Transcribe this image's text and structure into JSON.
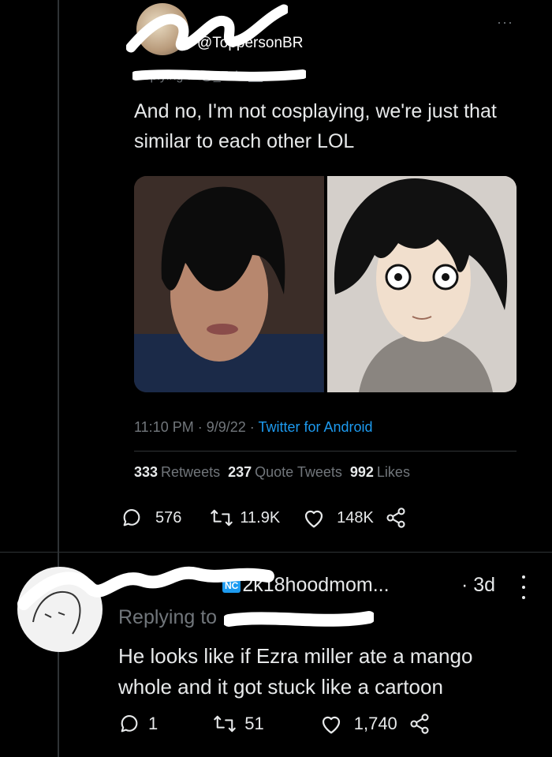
{
  "tweet1": {
    "handle": "@ToppersonBR",
    "more_label": "···",
    "replying_to": "Replying to @_Fuke__",
    "text": "And no, I'm not cosplaying, we're just that similar to each other LOL",
    "time": "11:10 PM",
    "date": "9/9/22",
    "client": "Twitter for Android",
    "retweets": "333",
    "retweets_label": "Retweets",
    "quote_tweets": "237",
    "quote_tweets_label": "Quote Tweets",
    "likes": "992",
    "likes_label": "Likes",
    "reply_count": "576",
    "retweet_count": "11.9K",
    "like_count": "148K"
  },
  "tweet2": {
    "handle": "2k18hoodmom...",
    "time": "· 3d",
    "replying_to": "Replying to",
    "text": "He looks like if Ezra miller ate a mango whole and it got stuck like a cartoon",
    "reply_count": "1",
    "retweet_count": "51",
    "like_count": "1,740"
  },
  "colors": {
    "background": "#000000",
    "text": "#e7e9ea",
    "muted": "#71767b",
    "link": "#1d9bf0",
    "divider": "#2f3336"
  }
}
